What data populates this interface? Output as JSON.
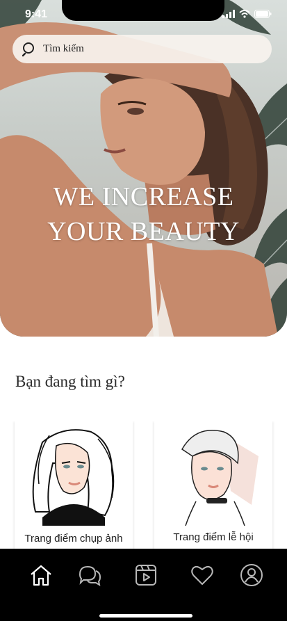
{
  "status_bar": {
    "time": "9:41"
  },
  "search": {
    "placeholder": "Tìm kiếm"
  },
  "hero": {
    "title_line1": "WE INCREASE",
    "title_line2": "YOUR BEAUTY"
  },
  "section": {
    "title": "Bạn đang tìm gì?"
  },
  "categories": [
    {
      "label": "Trang điểm chụp ảnh",
      "icon": "makeup-photo-illustration"
    },
    {
      "label": "Trang điểm lễ hội",
      "icon": "makeup-festival-illustration"
    }
  ],
  "tab_bar": {
    "items": [
      {
        "icon": "home-icon",
        "active": true
      },
      {
        "icon": "chat-icon",
        "active": false
      },
      {
        "icon": "video-icon",
        "active": false
      },
      {
        "icon": "heart-icon",
        "active": false
      },
      {
        "icon": "profile-icon",
        "active": false
      }
    ]
  },
  "colors": {
    "tab_bar_bg": "#000000",
    "icon_active": "#ffffff",
    "icon_inactive": "#b8b8b8"
  }
}
